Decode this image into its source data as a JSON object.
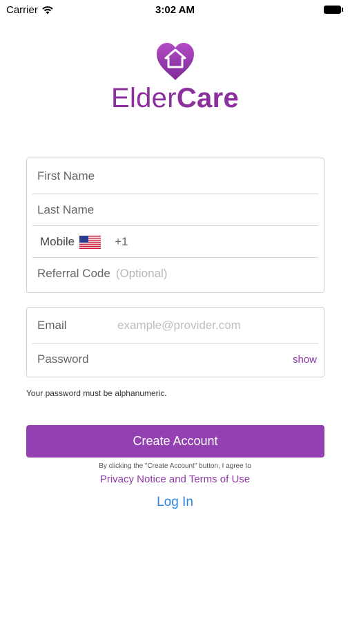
{
  "status_bar": {
    "carrier": "Carrier",
    "time": "3:02 AM"
  },
  "logo": {
    "brand_part1": "Elder",
    "brand_part2": "Care",
    "icon": "heart-house-icon",
    "color": "#8a2f9c"
  },
  "form1": {
    "first_name_placeholder": "First Name",
    "last_name_placeholder": "Last Name",
    "mobile_label": "Mobile",
    "country_code": "+1",
    "flag_icon": "us-flag-icon",
    "referral_label": "Referral Code",
    "referral_placeholder": "(Optional)"
  },
  "form2": {
    "email_label": "Email",
    "email_placeholder": "example@provider.com",
    "password_label": "Password",
    "show_label": "show"
  },
  "hint_text": "Your password must be alphanumeric.",
  "create_button_label": "Create Account",
  "consent_text": "By clicking the \"Create Account\" button, I agree to",
  "terms_link": "Privacy Notice and Terms of Use",
  "login_link": "Log In",
  "colors": {
    "accent": "#9340b0",
    "link_blue": "#2a86e0"
  }
}
